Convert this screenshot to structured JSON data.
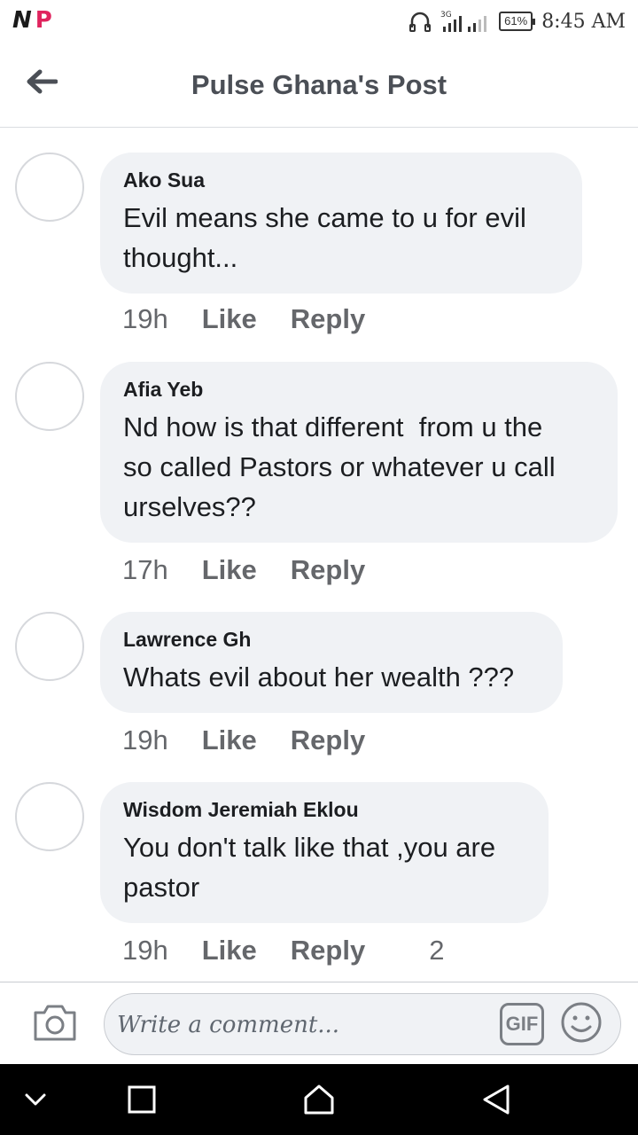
{
  "status_bar": {
    "left_icons": [
      "n-app-icon",
      "p-app-icon"
    ],
    "network": "3G",
    "battery": "61%",
    "time": "8:45 AM"
  },
  "header": {
    "title": "Pulse Ghana's Post",
    "back_icon": "arrow-left-icon"
  },
  "comments": [
    {
      "author": "Ako Sua",
      "text": "Evil means she came to u for evil\nthought...",
      "time": "19h",
      "like": "Like",
      "reply": "Reply",
      "reply_count": ""
    },
    {
      "author": "Afia Yeb",
      "text": "Nd how is that different  from u the\nso called Pastors or whatever u call\nurselves??",
      "time": "17h",
      "like": "Like",
      "reply": "Reply",
      "reply_count": ""
    },
    {
      "author": "Lawrence Gh",
      "text": "Whats evil about her wealth ???",
      "time": "19h",
      "like": "Like",
      "reply": "Reply",
      "reply_count": ""
    },
    {
      "author": "Wisdom Jeremiah Eklou",
      "text": "You don't talk like that ,you are\npastor",
      "time": "19h",
      "like": "Like",
      "reply": "Reply",
      "reply_count": "2"
    }
  ],
  "composer": {
    "placeholder": "Write a comment...",
    "gif_label": "GIF",
    "camera_icon": "camera-icon",
    "emoji_icon": "smiley-icon"
  },
  "nav_bar": {
    "icons": [
      "chevron-down-icon",
      "recents-square-icon",
      "home-icon",
      "back-triangle-icon"
    ]
  },
  "colors": {
    "bubble": "#f0f2f5",
    "secondary_text": "#65676b",
    "header_text": "#4b4f56"
  }
}
